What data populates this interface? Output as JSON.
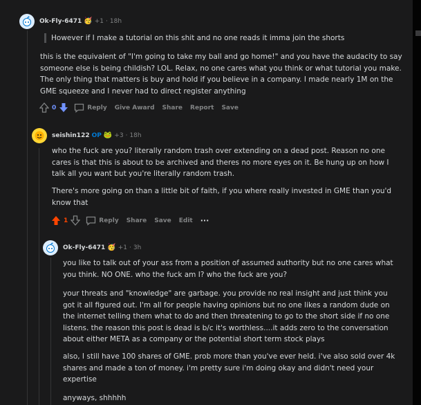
{
  "comments": [
    {
      "username": "Ok-Fly-6471",
      "flair": "🥳",
      "points": "+1",
      "time": "18h",
      "quote": "However if I make a tutorial on this shit and no one reads it imma join the shorts",
      "body": "this is the equivalent of \"I'm going to take my ball and go home!\" and you have the audacity to say someone else is being childish? LOL. Relax, no one cares what you think or what tutorial you make. The only thing that matters is buy and hold if you believe in a company. I made nearly 1M on the GME squeeze and I never had to direct register anything",
      "vote_count": "0",
      "actions": {
        "reply": "Reply",
        "give_award": "Give Award",
        "share": "Share",
        "report": "Report",
        "save": "Save"
      }
    },
    {
      "username": "seishin122",
      "op_badge": "OP",
      "flair": "🐸",
      "points": "+3",
      "time": "18h",
      "paragraphs": [
        "who the fuck are you? literally random trash over extending on a dead post. Reason no one cares is that this is about to be archived and theres no more eyes on it. Be hung up on how I talk all you want but you're literally random trash.",
        "There's more going on than a little bit of faith, if you where really invested in GME than you'd know that"
      ],
      "vote_count": "1",
      "actions": {
        "reply": "Reply",
        "share": "Share",
        "save": "Save",
        "edit": "Edit",
        "more": "···"
      }
    },
    {
      "username": "Ok-Fly-6471",
      "flair": "🥳",
      "points": "+1",
      "time": "3h",
      "paragraphs": [
        "you like to talk out of your ass from a position of assumed authority but no one cares what you think. NO ONE. who the fuck am I? who the fuck are you?",
        "your threats and \"knowledge\" are garbage. you provide no real insight and just think you got it all figured out. I'm all for people having opinions but no one likes a random dude on the internet telling them what to do and then threatening to go to the short side if no one listens. the reason this post is dead is b/c it's worthless....it adds zero to the conversation about either META as a company or the potential short term stock plays",
        "also, I still have 100 shares of GME. prob more than you've ever held. i've also sold over 4k shares and made a ton of money. i'm pretty sure i'm doing okay and didn't need your expertise",
        "anyways, shhhhh"
      ]
    }
  ],
  "colors": {
    "background": "#1a1a1b",
    "text": "#d7dadc",
    "muted": "#818384",
    "upvote_active": "#ff4500",
    "downvote_active": "#7193ff",
    "op_badge": "#0079d3",
    "thread_line": "#343536"
  },
  "icons": [
    "reddit-avatar-icon",
    "upvote-arrow-icon",
    "downvote-arrow-icon",
    "reply-bubble-icon",
    "more-dots-icon"
  ]
}
